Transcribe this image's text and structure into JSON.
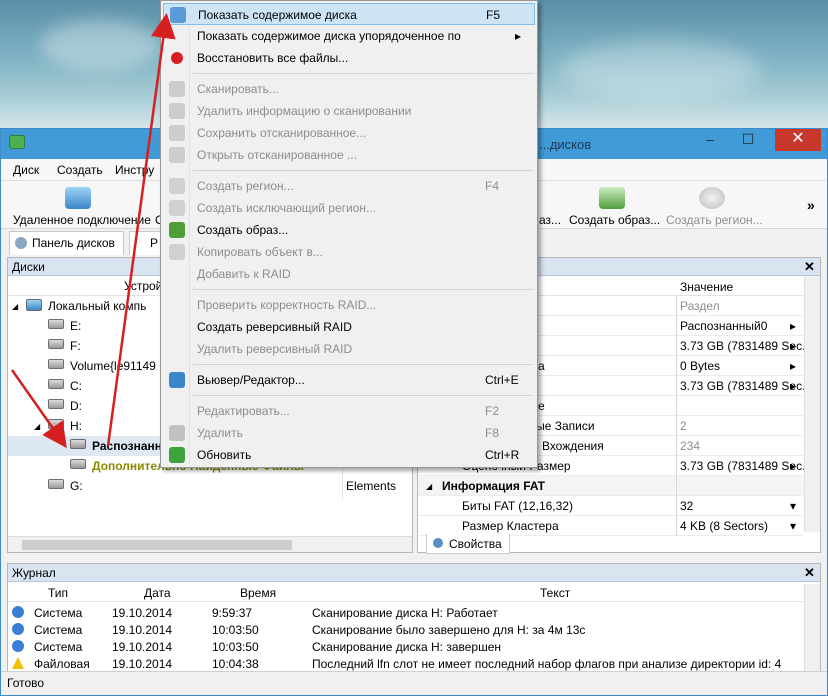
{
  "window": {
    "title": "...дисков",
    "menu": [
      "Диск",
      "Создать",
      "Инстру"
    ],
    "toolbar": {
      "remote_connect": "Удаленное подключение",
      "remote_letter": "С",
      "partial_label": "аз...",
      "create_image": "Создать образ...",
      "create_region": "Создать регион...",
      "more": "»"
    },
    "tabs": [
      "Панель дисков",
      "Р"
    ]
  },
  "disks_pane": {
    "header": "Диски",
    "column_device": "Устрой",
    "tree": [
      {
        "label": "Локальный компь",
        "level": 0,
        "value": ""
      },
      {
        "label": "E:",
        "level": 1,
        "value": ""
      },
      {
        "label": "F:",
        "level": 1,
        "value": ""
      },
      {
        "label": "Volume{le91149",
        "level": 1,
        "value": ""
      },
      {
        "label": "C:",
        "level": 1,
        "value": ""
      },
      {
        "label": "D:",
        "level": 1,
        "value": ""
      },
      {
        "label": "H:",
        "level": 1,
        "value": ""
      },
      {
        "label": "Распознанн",
        "level": 2,
        "value": ""
      },
      {
        "label": "Дополнительно Найденные Файлы",
        "level": 2,
        "value": ""
      },
      {
        "label": "G:",
        "level": 1,
        "value": "Elements"
      }
    ]
  },
  "properties_pane": {
    "column_value": "Значение",
    "rows": [
      {
        "name": "",
        "value": "Раздел",
        "disabled": true
      },
      {
        "name": "",
        "value": "Распознанный0",
        "disabled": false,
        "arrow": "▸"
      },
      {
        "name": "",
        "value": "3.73 GB (7831489 Sec.",
        "disabled": false,
        "arrow": "▸"
      },
      {
        "name": "а",
        "value": "0 Bytes",
        "disabled": false,
        "arrow": "▸"
      },
      {
        "name": "",
        "value": "3.73 GB (7831489 Sec.",
        "disabled": false,
        "arrow": "▸"
      },
      {
        "name": "е",
        "value": "",
        "disabled": false,
        "arrow": ""
      },
      {
        "name": "ые Загрузочные Записи",
        "value": "2",
        "disabled": true,
        "arrow": ""
      },
      {
        "name": "ые Файловые Вхождения",
        "value": "234",
        "disabled": true,
        "arrow": ""
      },
      {
        "name": "Оценочный Размер",
        "value": "3.73 GB (7831489 Sec.",
        "disabled": false,
        "arrow": "▸"
      },
      {
        "name": "Информация FAT",
        "value": "",
        "disabled": false,
        "arrow": "",
        "section": true
      },
      {
        "name": "Биты FAT (12,16,32)",
        "value": "32",
        "disabled": false,
        "arrow": "▾"
      },
      {
        "name": "Размер Кластера",
        "value": "4 KB (8 Sectors)",
        "disabled": false,
        "arrow": "▾"
      }
    ],
    "tab": "Свойства"
  },
  "journal": {
    "header": "Журнал",
    "columns": [
      "Тип",
      "Дата",
      "Время",
      "Текст"
    ],
    "rows": [
      {
        "type": "Система",
        "date": "19.10.2014",
        "time": "9:59:37",
        "text": "Сканирование диска H: Работает",
        "icon": "info"
      },
      {
        "type": "Система",
        "date": "19.10.2014",
        "time": "10:03:50",
        "text": "Сканирование было завершено для H: за 4м 13с",
        "icon": "info"
      },
      {
        "type": "Система",
        "date": "19.10.2014",
        "time": "10:03:50",
        "text": "Сканирование диска H: завершен",
        "icon": "info"
      },
      {
        "type": "Файловая",
        "date": "19.10.2014",
        "time": "10:04:38",
        "text": "Последний lfn слот не имеет последний набор флагов при анализе директории id: 4",
        "icon": "warning"
      }
    ]
  },
  "status": "Готово",
  "context_menu": {
    "items": [
      {
        "label": "Показать содержимое диска",
        "shortcut": "F5",
        "disabled": false,
        "highlighted": true,
        "icon": "disk-view-icon"
      },
      {
        "label": "Показать содержимое диска упорядоченное по",
        "shortcut": "▸",
        "disabled": false,
        "icon": ""
      },
      {
        "label": "Восстановить все файлы...",
        "shortcut": "",
        "disabled": false,
        "icon": "restore-icon"
      },
      {
        "sep": true
      },
      {
        "label": "Сканировать...",
        "shortcut": "",
        "disabled": true,
        "icon": "scan-icon"
      },
      {
        "label": "Удалить информацию о сканировании",
        "shortcut": "",
        "disabled": true,
        "icon": "delete-scan-icon"
      },
      {
        "label": "Сохранить отсканированное...",
        "shortcut": "",
        "disabled": true,
        "icon": "save-scan-icon"
      },
      {
        "label": "Открыть отсканированное ...",
        "shortcut": "",
        "disabled": true,
        "icon": "open-scan-icon"
      },
      {
        "sep": true
      },
      {
        "label": "Создать регион...",
        "shortcut": "F4",
        "disabled": true,
        "icon": "region-icon"
      },
      {
        "label": "Создать исключающий регион...",
        "shortcut": "",
        "disabled": true,
        "icon": "exclude-region-icon"
      },
      {
        "label": "Создать образ...",
        "shortcut": "",
        "disabled": false,
        "icon": "image-icon"
      },
      {
        "label": "Копировать объект в...",
        "shortcut": "",
        "disabled": true,
        "icon": "copy-icon"
      },
      {
        "label": "Добавить к RAID",
        "shortcut": "",
        "disabled": true,
        "icon": ""
      },
      {
        "sep": true
      },
      {
        "label": "Проверить корректность RAID...",
        "shortcut": "",
        "disabled": true,
        "icon": ""
      },
      {
        "label": "Создать реверсивный RAID",
        "shortcut": "",
        "disabled": false,
        "icon": ""
      },
      {
        "label": "Удалить реверсивный RAID",
        "shortcut": "",
        "disabled": true,
        "icon": ""
      },
      {
        "sep": true
      },
      {
        "label": "Вьювер/Редактор...",
        "shortcut": "Ctrl+E",
        "disabled": false,
        "icon": "viewer-icon"
      },
      {
        "sep": true
      },
      {
        "label": "Редактировать...",
        "shortcut": "F2",
        "disabled": true,
        "icon": ""
      },
      {
        "label": "Удалить",
        "shortcut": "F8",
        "disabled": true,
        "icon": "delete-icon"
      },
      {
        "label": "Обновить",
        "shortcut": "Ctrl+R",
        "disabled": false,
        "icon": "refresh-icon"
      }
    ]
  },
  "colors": {
    "accent": "#3f9ad6",
    "arrow": "#d62020",
    "highlight": "#cde4f7",
    "close": "#c7372c"
  }
}
